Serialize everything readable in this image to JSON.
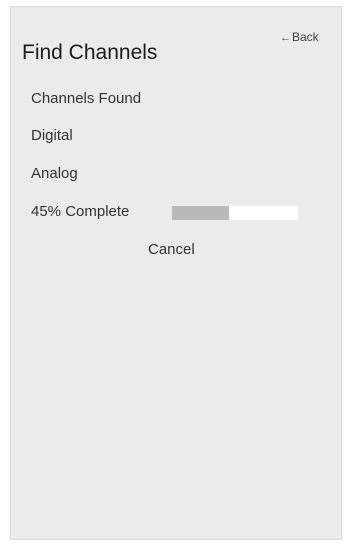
{
  "header": {
    "title": "Find Channels",
    "back_arrow": "←",
    "back_label": "Back"
  },
  "scan": {
    "channels_found_label": "Channels Found",
    "digital_label": "Digital",
    "analog_label": "Analog",
    "progress_label": "45% Complete",
    "progress_fraction": 0.45
  },
  "actions": {
    "cancel_label": "Cancel"
  },
  "colors": {
    "panel_background": "#ebebeb",
    "progress_track": "#ffffff",
    "progress_fill": "#b9b9b9"
  }
}
